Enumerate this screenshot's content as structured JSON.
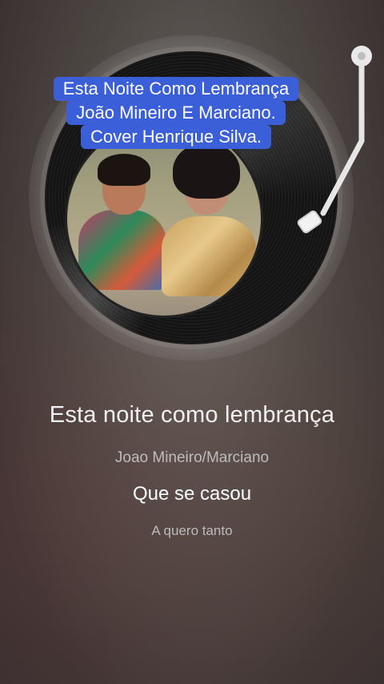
{
  "caption": {
    "line1": "Esta Noite Como Lembrança",
    "line2": "João Mineiro E Marciano.",
    "line3": "Cover Henrique Silva."
  },
  "player": {
    "song_title": "Esta noite como lembrança",
    "artist": "Joao Mineiro/Marciano",
    "current_lyric": "Que se casou",
    "next_lyric": "A quero tanto"
  },
  "colors": {
    "caption_bg": "#3a5fd9",
    "text_primary": "#ffffff",
    "text_secondary": "#bdbdbd"
  },
  "icons": {
    "record": "vinyl-record-icon",
    "tonearm": "tonearm-icon"
  }
}
